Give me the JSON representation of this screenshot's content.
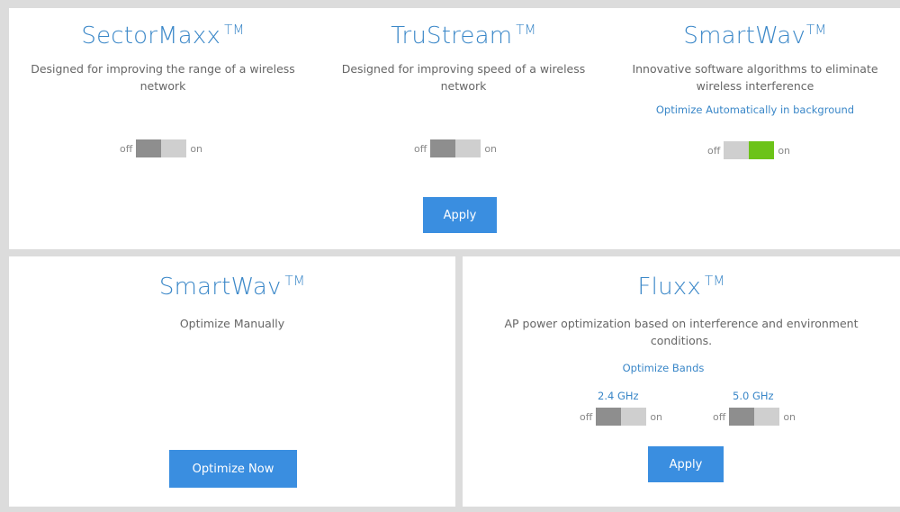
{
  "sectormaxx": {
    "title": "SectorMaxx",
    "tm": "TM",
    "description": "Designed for improving the range of a wireless network",
    "toggle_off": "off",
    "toggle_on": "on",
    "enabled": false
  },
  "trustream": {
    "title": "TruStream",
    "tm": "TM",
    "description": "Designed for improving speed of a wireless network",
    "toggle_off": "off",
    "toggle_on": "on",
    "enabled": false
  },
  "smartwav_auto": {
    "title": "SmartWav",
    "tm": "TM",
    "description": "Innovative software algorithms to eliminate wireless interference",
    "optimize_label": "Optimize Automatically in background",
    "toggle_off": "off",
    "toggle_on": "on",
    "enabled": true
  },
  "top_apply_label": "Apply",
  "smartwav_manual": {
    "title": "SmartWav",
    "tm": "TM",
    "description": "Optimize Manually",
    "button_label": "Optimize Now"
  },
  "fluxx": {
    "title": "Fluxx",
    "tm": "TM",
    "description": "AP power optimization based on interference and environment conditions.",
    "bands_label": "Optimize Bands",
    "band_24": {
      "label": "2.4 GHz",
      "toggle_off": "off",
      "toggle_on": "on",
      "enabled": false
    },
    "band_50": {
      "label": "5.0 GHz",
      "toggle_off": "off",
      "toggle_on": "on",
      "enabled": false
    },
    "apply_label": "Apply"
  },
  "colors": {
    "accent": "#3a87c8",
    "button": "#3a8ee0",
    "toggle_on": "#6cc318",
    "toggle_dark": "#8e8e8e",
    "toggle_light": "#cfcfcf",
    "background": "#dcdcdc"
  }
}
